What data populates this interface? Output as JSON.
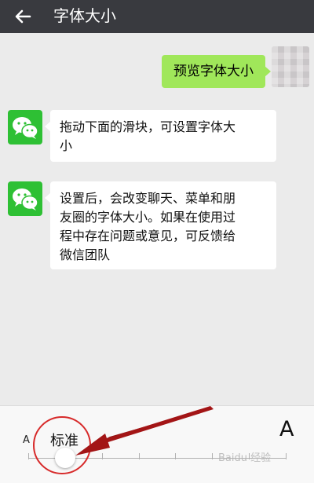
{
  "header": {
    "title": "字体大小"
  },
  "chat": {
    "outgoing": {
      "text": "预览字体大小"
    },
    "messages": [
      {
        "lines": [
          "拖动下面的滑块，可设置字体大",
          "小"
        ]
      },
      {
        "lines": [
          "设置后，会改变聊天、菜单和朋",
          "友圈的字体大小。如果在使用过",
          "程中存在问题或意见，可反馈给",
          "微信团队"
        ]
      }
    ]
  },
  "font_slider": {
    "small_label": "A",
    "large_label": "A",
    "current_label": "标准",
    "steps": 8,
    "current_step": 1
  },
  "colors": {
    "topbar": "#393a3f",
    "outgoing_bubble": "#a0e75a",
    "wechat_green": "#2ec034",
    "annotation_red": "#d72a2a"
  }
}
